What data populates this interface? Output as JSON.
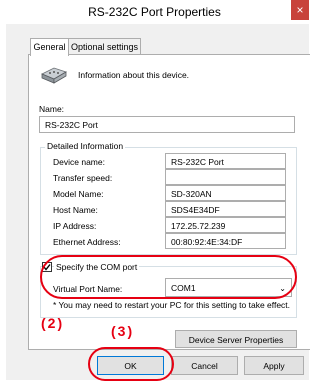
{
  "window": {
    "title": "RS-232C Port Properties",
    "close_label": "×"
  },
  "tabs": [
    {
      "label": "General"
    },
    {
      "label": "Optional settings"
    }
  ],
  "info": {
    "text": "Information about this device."
  },
  "name": {
    "label": "Name:",
    "value": "RS-232C Port"
  },
  "detailed": {
    "label": "Detailed Information",
    "rows": [
      {
        "label": "Device name:",
        "value": "RS-232C Port"
      },
      {
        "label": "Transfer speed:",
        "value": ""
      },
      {
        "label": "Model Name:",
        "value": "SD-320AN"
      },
      {
        "label": "Host Name:",
        "value": "SDS4E34DF"
      },
      {
        "label": "IP Address:",
        "value": "172.25.72.239"
      },
      {
        "label": "Ethernet Address:",
        "value": "00:80:92:4E:34:DF"
      }
    ]
  },
  "com": {
    "checkbox_label": "Specify the COM port",
    "checked": true,
    "port_label": "Virtual Port Name:",
    "port_value": "COM1",
    "note": "* You may need to restart your PC for this setting to take effect."
  },
  "buttons": {
    "device_server": "Device Server Properties",
    "ok": "OK",
    "cancel": "Cancel",
    "apply": "Apply"
  },
  "annotations": {
    "n2": "(2)",
    "n3": "(3)",
    "color": "#e60012"
  }
}
